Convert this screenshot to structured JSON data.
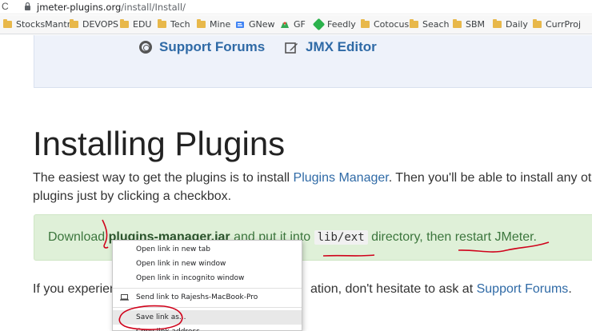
{
  "addressbar": {
    "reload_glyph": "C",
    "url_host": "jmeter-plugins.org",
    "url_path": "/install/Install/"
  },
  "bookmarks": [
    {
      "label": "StocksMantra",
      "icon": "folder-icon"
    },
    {
      "label": "DEVOPS",
      "icon": "folder-icon"
    },
    {
      "label": "EDU",
      "icon": "folder-icon"
    },
    {
      "label": "Tech",
      "icon": "folder-icon"
    },
    {
      "label": "Mine",
      "icon": "folder-icon"
    },
    {
      "label": "GNew",
      "icon": "gnews-icon"
    },
    {
      "label": "GF",
      "icon": "gf-icon"
    },
    {
      "label": "Feedly",
      "icon": "feedly-icon"
    },
    {
      "label": "Cotocus",
      "icon": "folder-icon"
    },
    {
      "label": "Seach",
      "icon": "folder-icon"
    },
    {
      "label": "SBM",
      "icon": "folder-icon"
    },
    {
      "label": "Daily",
      "icon": "folder-icon"
    },
    {
      "label": "CurrProj",
      "icon": "folder-icon"
    }
  ],
  "nav": {
    "support_forums": "Support Forums",
    "jmx_editor": "JMX Editor"
  },
  "page": {
    "title": "Installing Plugins",
    "intro_1a": "The easiest way to get the plugins is to install ",
    "intro_1_link": "Plugins Manager",
    "intro_1b": ". Then you'll be able to install any oth",
    "intro_2": "plugins just by clicking a checkbox.",
    "download_prefix": "Download ",
    "download_link": "plugins-manager.jar",
    "download_mid": " and put it into ",
    "download_code": "lib/ext",
    "download_suffix": " directory, then restart JMeter.",
    "experience_prefix": "If you experien",
    "experience_mid": "ation, don't hesitate to ask at ",
    "experience_link": "Support Forums",
    "experience_end": "."
  },
  "context_menu": {
    "items": [
      "Open link in new tab",
      "Open link in new window",
      "Open link in incognito window",
      "Send link to Rajeshs-MacBook-Pro",
      "Save link as..."
    ],
    "highlighted": "Save link as...",
    "partial_item": "Copy link address"
  },
  "colors": {
    "link": "#2f6aa6",
    "success_bg": "#dff0d8",
    "annotation_red": "#d0021b"
  }
}
